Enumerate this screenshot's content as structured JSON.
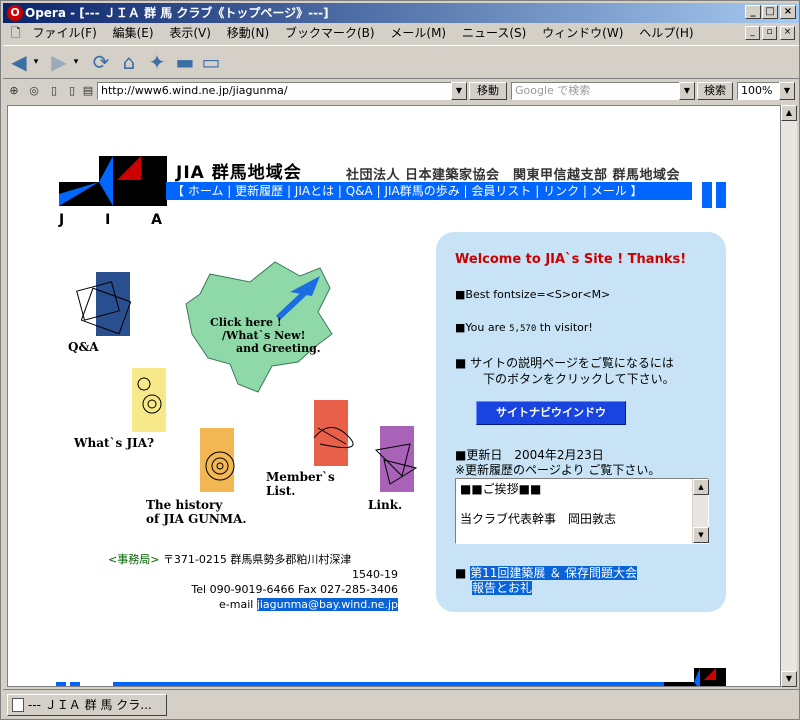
{
  "window": {
    "title": "Opera - [--- ＪＩＡ 群 馬 クラブ《トップページ》---]",
    "minimize": "_",
    "maximize": "□",
    "close": "×",
    "restore": "▫"
  },
  "menu": [
    "ファイル(F)",
    "編集(E)",
    "表示(V)",
    "移動(N)",
    "ブックマーク(B)",
    "メール(M)",
    "ニュース(S)",
    "ウィンドウ(W)",
    "ヘルプ(H)"
  ],
  "address": {
    "url": "http://www6.wind.ne.jp/jiagunma/",
    "go": "移動",
    "search_placeholder": "Google で検索",
    "search_button": "検索",
    "zoom": "100%"
  },
  "header": {
    "logo_text": "J  I  A",
    "site_title": "JIA 群馬地域会",
    "subtitle": "社団法人 日本建築家協会　関東甲信越支部 群馬地域会",
    "nav": "【 ホーム | 更新履歴 | JIAとは | Q&A | JIA群馬の歩み | 会員リスト | リンク | メール 】"
  },
  "map": {
    "bubble_line1": "Click here !",
    "bubble_line2": "/What`s New!",
    "bubble_line3": "and Greeting."
  },
  "links": {
    "qa": "Q&A",
    "whatsjia": "What`s JIA?",
    "history_1": "The history",
    "history_2": "of JIA GUNMA.",
    "member_1": "Member`s",
    "member_2": "List.",
    "link": "Link."
  },
  "office": {
    "label": "<事務局>",
    "address_1": "〒371-0215 群馬県勢多郡粕川村深津",
    "address_2": "1540-19",
    "phone": "Tel 090-9019-6466 Fax 027-285-3406",
    "email_label": "e-mail",
    "email": "jiagunma@bay.wind.ne.jp"
  },
  "panel": {
    "welcome": "Welcome to JIA`s Site !  Thanks!",
    "fontsize": "■Best fontsize=<S>or<M>",
    "visitor_pre": "■You are ",
    "visitor_count": "5,570",
    "visitor_post": " th visitor!",
    "guide_1": "■ サイトの説明ページをご覧になるには",
    "guide_2": "下のボタンをクリックして下さい。",
    "navi_button": "サイトナビウインドウ",
    "updated_1": "■更新日　2004年2月23日",
    "updated_2": "※更新履歴のページより ご覧下さい。",
    "textarea_line1": "■■ご挨拶■■",
    "textarea_line2": "当クラブ代表幹事　岡田敦志",
    "news_1": "第11回建築展 ＆ 保存問題大会",
    "news_2": "報告とお礼"
  },
  "status": {
    "tab": "--- ＪＩＡ 群 馬 クラ..."
  }
}
